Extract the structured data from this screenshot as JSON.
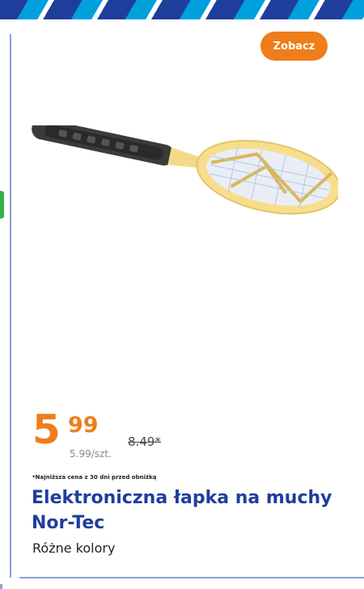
{
  "button": {
    "label": "Zobacz"
  },
  "price": {
    "main": "5",
    "cents": "99",
    "unit_price": "5.99/szt.",
    "old_price": "8.49*"
  },
  "note": "*Najniższa cena z 30 dni przed obniżką",
  "product": {
    "title": "Elektroniczna łapka na muchy Nor-Tec",
    "subtitle": "Różne kolory",
    "image": "electric-fly-swatter-image"
  },
  "colors": {
    "accent": "#ef7d1a",
    "brand": "#1f3e9c",
    "stripe_light": "#00a0dc",
    "tag": "#2db34a"
  }
}
